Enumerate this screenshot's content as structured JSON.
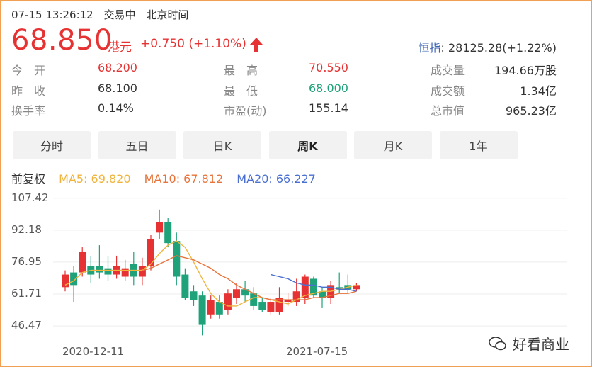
{
  "header": {
    "datetime": "07-15 13:26:12",
    "status": "交易中",
    "timezone": "北京时间",
    "price": "68.850",
    "currency": "港元",
    "change": "+0.750 (+1.10%)",
    "index_label": "恒指",
    "index_value": ": 28125.28(+1.22%)"
  },
  "stats": [
    {
      "label": "今　开",
      "value": "68.200",
      "color": "#e63232"
    },
    {
      "label": "最　高",
      "value": "70.550",
      "color": "#e63232"
    },
    {
      "label": "成交量",
      "value": "194.66万股",
      "color": "#333"
    },
    {
      "label": "昨　收",
      "value": "68.100",
      "color": "#333"
    },
    {
      "label": "最　低",
      "value": "68.000",
      "color": "#1fa27a"
    },
    {
      "label": "成交额",
      "value": "1.34亿",
      "color": "#333"
    },
    {
      "label": "换手率",
      "value": "0.14%",
      "color": "#333"
    },
    {
      "label": "市盈(动)",
      "value": "155.14",
      "color": "#333"
    },
    {
      "label": "总市值",
      "value": "965.23亿",
      "color": "#333"
    }
  ],
  "tabs": [
    "分时",
    "五日",
    "日K",
    "周K",
    "月K",
    "1年"
  ],
  "active_tab": "周K",
  "ma": {
    "adjust": "前复权",
    "ma5": "MA5: 69.820",
    "ma10": "MA10: 67.812",
    "ma20": "MA20: 66.227"
  },
  "colors": {
    "up": "#e63232",
    "down": "#1fa27a",
    "ma5": "#f0b43c",
    "ma10": "#e8743b",
    "ma20": "#4a6fd0"
  },
  "watermark": "好看商业",
  "chart_data": {
    "type": "candlestick",
    "y_ticks": [
      "107.42",
      "92.18",
      "76.95",
      "61.71",
      "46.47"
    ],
    "y_tick_values": [
      107.42,
      92.18,
      76.95,
      61.71,
      46.47
    ],
    "x_ticks": [
      "2020-12-11",
      "2021-07-15"
    ],
    "ylim": [
      44.5,
      108
    ],
    "candles": [
      {
        "o": 65,
        "c": 71,
        "h": 73,
        "l": 63
      },
      {
        "o": 72,
        "c": 66,
        "h": 75,
        "l": 58
      },
      {
        "o": 72,
        "c": 82,
        "h": 84,
        "l": 70
      },
      {
        "o": 75,
        "c": 71,
        "h": 80,
        "l": 67
      },
      {
        "o": 75,
        "c": 72,
        "h": 85,
        "l": 69
      },
      {
        "o": 74,
        "c": 71,
        "h": 80,
        "l": 68
      },
      {
        "o": 71,
        "c": 75,
        "h": 80,
        "l": 69
      },
      {
        "o": 70,
        "c": 74,
        "h": 78,
        "l": 68
      },
      {
        "o": 76,
        "c": 70,
        "h": 82,
        "l": 66
      },
      {
        "o": 70,
        "c": 75,
        "h": 79,
        "l": 66
      },
      {
        "o": 75,
        "c": 88,
        "h": 90,
        "l": 73
      },
      {
        "o": 91,
        "c": 96,
        "h": 102,
        "l": 88
      },
      {
        "o": 96,
        "c": 86,
        "h": 98,
        "l": 84
      },
      {
        "o": 87,
        "c": 70,
        "h": 91,
        "l": 66
      },
      {
        "o": 71,
        "c": 60,
        "h": 74,
        "l": 59
      },
      {
        "o": 63,
        "c": 59,
        "h": 66,
        "l": 56
      },
      {
        "o": 61,
        "c": 47,
        "h": 63,
        "l": 42
      },
      {
        "o": 52,
        "c": 59,
        "h": 61,
        "l": 50
      },
      {
        "o": 58,
        "c": 52,
        "h": 61,
        "l": 50
      },
      {
        "o": 54,
        "c": 62,
        "h": 64,
        "l": 52
      },
      {
        "o": 60,
        "c": 64,
        "h": 67,
        "l": 57
      },
      {
        "o": 64,
        "c": 61,
        "h": 68,
        "l": 58
      },
      {
        "o": 62,
        "c": 56,
        "h": 65,
        "l": 54
      },
      {
        "o": 58,
        "c": 54,
        "h": 60,
        "l": 53
      },
      {
        "o": 53,
        "c": 58,
        "h": 60,
        "l": 52
      },
      {
        "o": 53,
        "c": 60,
        "h": 65,
        "l": 52
      },
      {
        "o": 58,
        "c": 59,
        "h": 62,
        "l": 56
      },
      {
        "o": 58,
        "c": 63,
        "h": 69,
        "l": 56
      },
      {
        "o": 60,
        "c": 70,
        "h": 71,
        "l": 57
      },
      {
        "o": 69,
        "c": 61,
        "h": 70,
        "l": 60
      },
      {
        "o": 63,
        "c": 60,
        "h": 65,
        "l": 55
      },
      {
        "o": 60,
        "c": 66,
        "h": 68,
        "l": 57
      },
      {
        "o": 65,
        "c": 64,
        "h": 72,
        "l": 62
      },
      {
        "o": 66,
        "c": 64,
        "h": 71,
        "l": 62
      },
      {
        "o": 64,
        "c": 66,
        "h": 67,
        "l": 63
      }
    ],
    "ma5": [
      66,
      68,
      72,
      73,
      73,
      73,
      73,
      73,
      73,
      73,
      76,
      81,
      85,
      87,
      84,
      77,
      69,
      62,
      58,
      56,
      56,
      58,
      60,
      60,
      59,
      58,
      57,
      59,
      61,
      62,
      63,
      63,
      64,
      65,
      66
    ],
    "ma10": [
      null,
      null,
      null,
      null,
      null,
      null,
      null,
      null,
      null,
      73,
      74,
      76,
      78,
      80,
      79,
      78,
      76,
      74,
      71,
      69,
      66,
      64,
      62,
      60,
      59,
      59,
      59,
      59,
      59,
      60,
      60,
      61,
      62,
      62,
      63
    ],
    "ma20": [
      null,
      null,
      null,
      null,
      null,
      null,
      null,
      null,
      null,
      null,
      null,
      null,
      null,
      null,
      null,
      null,
      null,
      null,
      null,
      null,
      null,
      null,
      null,
      null,
      71,
      70,
      69,
      67,
      66,
      66,
      65,
      65,
      64,
      64,
      63
    ]
  }
}
